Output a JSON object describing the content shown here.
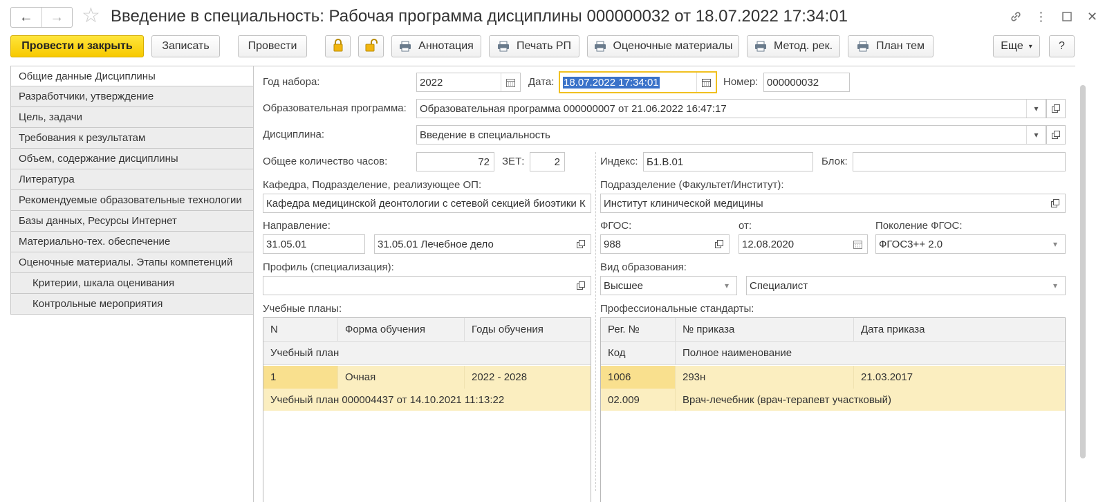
{
  "window": {
    "title": "Введение в специальность: Рабочая программа дисциплины 000000032 от 18.07.2022 17:34:01"
  },
  "toolbar": {
    "post_close": "Провести и закрыть",
    "save": "Записать",
    "post": "Провести",
    "annotation": "Аннотация",
    "print_rp": "Печать РП",
    "assessment": "Оценочные материалы",
    "method": "Метод. рек.",
    "topics_plan": "План тем",
    "more": "Еще",
    "help": "?"
  },
  "leftnav": {
    "items": [
      "Общие данные Дисциплины",
      "Разработчики, утверждение",
      "Цель, задачи",
      "Требования к результатам",
      "Объем, содержание дисциплины",
      "Литература",
      "Рекомендуемые образовательные технологии",
      "Базы данных, Ресурсы Интернет",
      "Материально-тех. обеспечение",
      "Оценочные материалы. Этапы компетенций",
      "Критерии, шкала оценивания",
      "Контрольные мероприятия"
    ]
  },
  "form": {
    "year_label": "Год набора:",
    "year_value": "2022",
    "date_label": "Дата:",
    "date_value": "18.07.2022 17:34:01",
    "number_label": "Номер:",
    "number_value": "000000032",
    "program_label": "Образовательная программа:",
    "program_value": "Образовательная программа 000000007 от 21.06.2022 16:47:17",
    "discipline_label": "Дисциплина:",
    "discipline_value": "Введение в специальность",
    "hours_label": "Общее количество часов:",
    "hours_value": "72",
    "zet_label": "ЗЕТ:",
    "zet_value": "2",
    "index_label": "Индекс:",
    "index_value": "Б1.В.01",
    "block_label": "Блок:",
    "block_value": "",
    "dept_label": "Кафедра, Подразделение, реализующее ОП:",
    "dept_value": "Кафедра медицинской деонтологии с сетевой секцией биоэтики К",
    "faculty_label": "Подразделение (Факультет/Институт):",
    "faculty_value": "Институт клинической медицины",
    "direction_label": "Направление:",
    "direction_code": "31.05.01",
    "direction_name": "31.05.01 Лечебное дело",
    "fgos_label": "ФГОС:",
    "fgos_value": "988",
    "from_label": "от:",
    "from_value": "12.08.2020",
    "gen_label": "Поколение ФГОС:",
    "gen_value": "ФГОС3++ 2.0",
    "profile_label": "Профиль (специализация):",
    "profile_value": "",
    "edu_kind_label": "Вид образования:",
    "edu_kind_value": "Высшее",
    "edu_level_value": "Специалист",
    "plans_label": "Учебные планы:",
    "standards_label": "Профессиональные стандарты:"
  },
  "plans_table": {
    "headers": [
      "N",
      "Форма обучения",
      "Годы обучения"
    ],
    "subheader": "Учебный план",
    "rows": [
      {
        "n": "1",
        "form": "Очная",
        "years": "2022 - 2028",
        "plan": "Учебный план 000004437 от 14.10.2021 11:13:22"
      }
    ]
  },
  "standards_table": {
    "headers": [
      "Рег. №",
      "№ приказа",
      "Дата приказа"
    ],
    "subheaders": [
      "Код",
      "Полное наименование"
    ],
    "rows": [
      {
        "reg": "1006",
        "order": "293н",
        "date": "21.03.2017",
        "code": "02.009",
        "name": "Врач-лечебник (врач-терапевт участковый)"
      }
    ]
  }
}
